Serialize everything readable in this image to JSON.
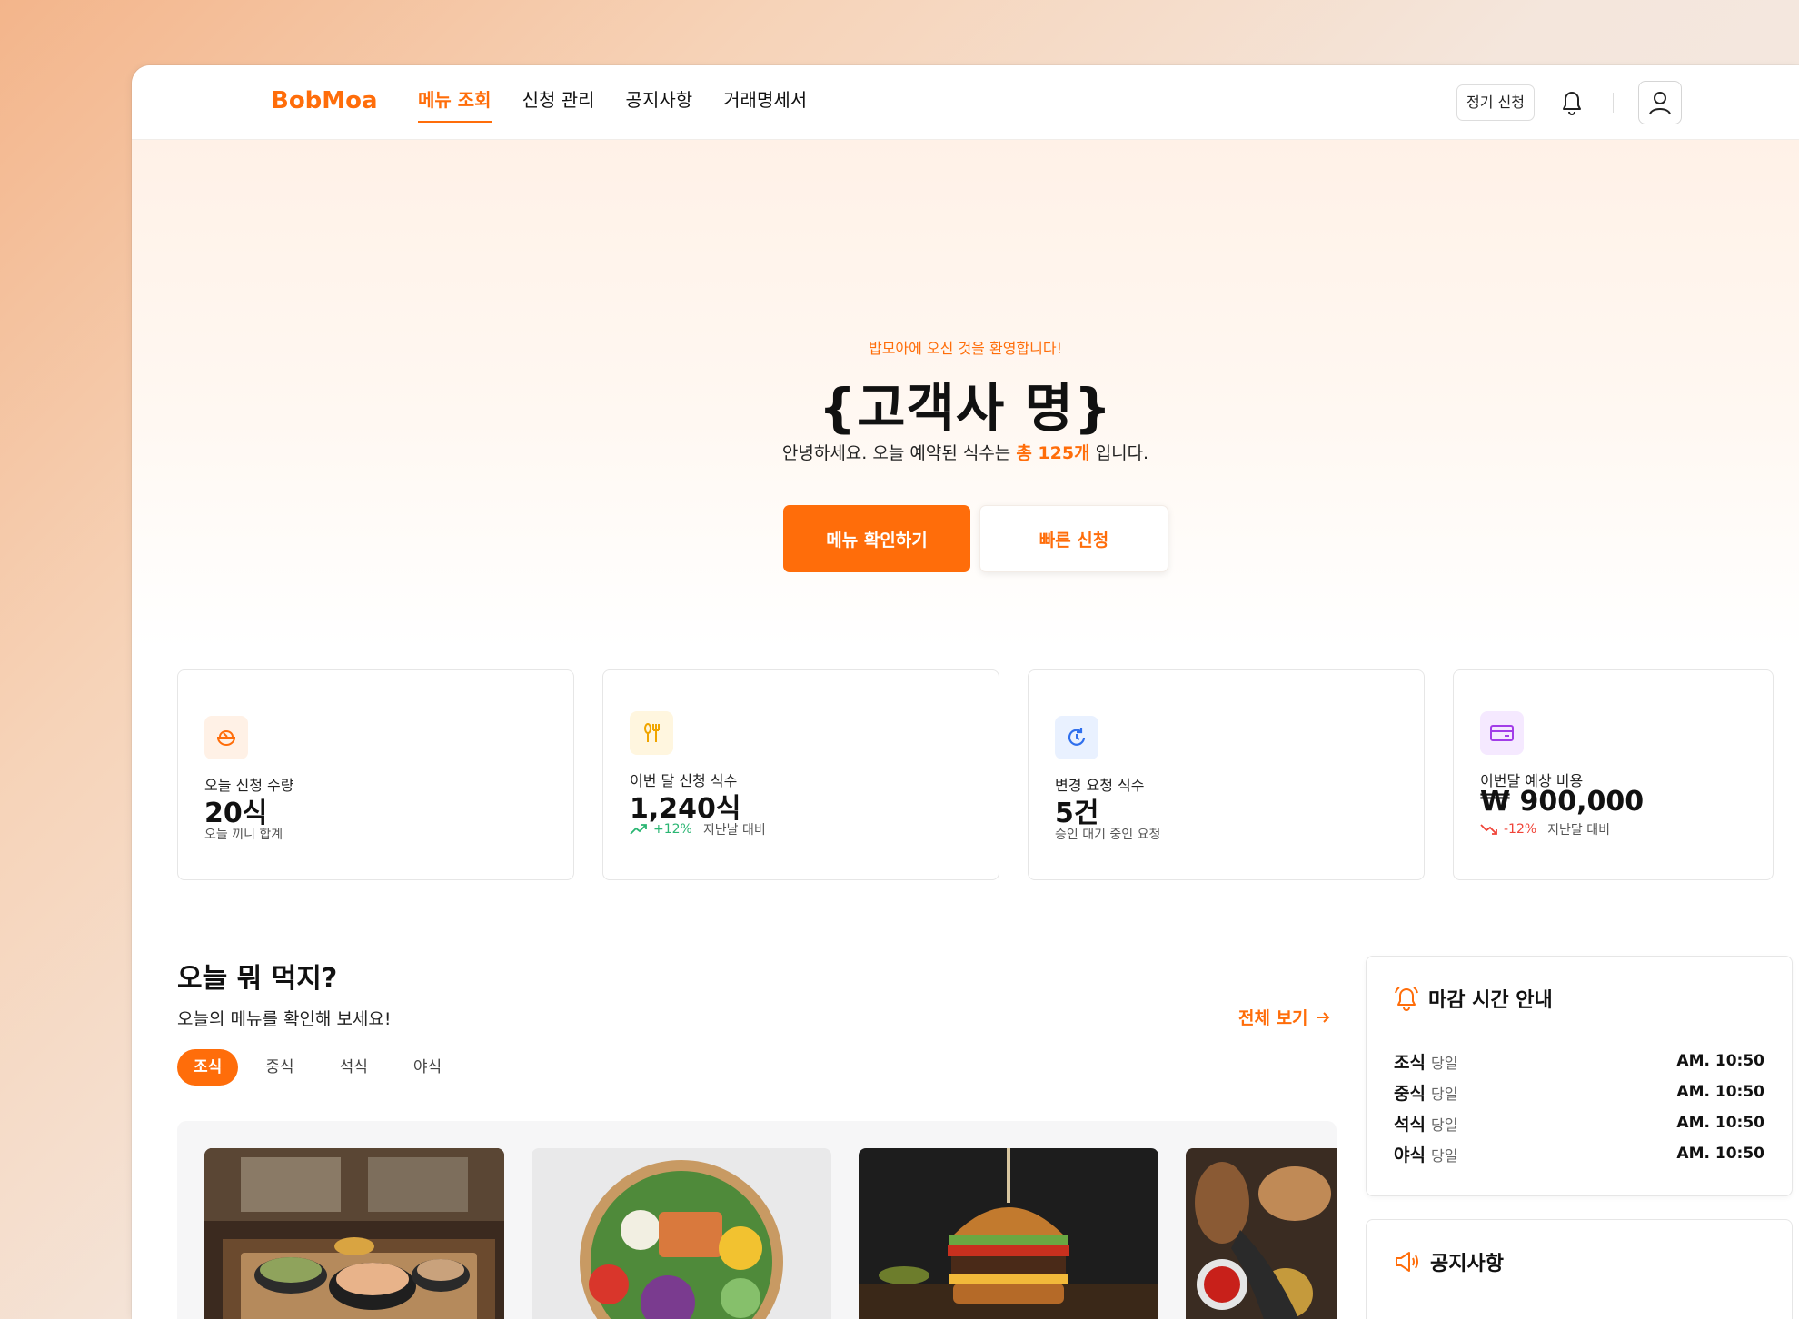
{
  "header": {
    "logo": "BobMoa",
    "nav": [
      "메뉴 조회",
      "신청 관리",
      "공지사항",
      "거래명세서"
    ],
    "regular_btn": "정기 신청"
  },
  "hero": {
    "welcome": "밥모아에 오신 것을 환영합니다!",
    "title": "{고객사 명}",
    "sub_prefix": "안녕하세요. 오늘 예약된 식수는 ",
    "sub_highlight": "총 125개",
    "sub_suffix": " 입니다.",
    "btn_primary": "메뉴 확인하기",
    "btn_secondary": "빠른 신청"
  },
  "stats": [
    {
      "label": "오늘 신청 수량",
      "value": "20식",
      "note": "오늘 끼니 합계",
      "icon": "bowl-icon"
    },
    {
      "label": "이번 달 신청 식수",
      "value": "1,240식",
      "trend": "+12%",
      "note": "지난날 대비",
      "icon": "utensils-icon"
    },
    {
      "label": "변경 요청 식수",
      "value": "5건",
      "note": "승인 대기 중인 요청",
      "icon": "refresh-icon"
    },
    {
      "label": "이번달 예상 비용",
      "value": "₩ 900,000",
      "trend": "-12%",
      "note": "지난달 대비",
      "icon": "card-icon"
    }
  ],
  "menu_section": {
    "title": "오늘 뭐 먹지?",
    "subtitle": "오늘의 메뉴를 확인해 보세요!",
    "view_all": "전체 보기",
    "tabs": [
      "조식",
      "중식",
      "석식",
      "야식"
    ]
  },
  "deadline": {
    "title": "마감 시간 안내",
    "rows": [
      {
        "meal": "조식",
        "when": "당일",
        "time": "AM. 10:50"
      },
      {
        "meal": "중식",
        "when": "당일",
        "time": "AM. 10:50"
      },
      {
        "meal": "석식",
        "when": "당일",
        "time": "AM. 10:50"
      },
      {
        "meal": "야식",
        "when": "당일",
        "time": "AM. 10:50"
      }
    ]
  },
  "notice": {
    "title": "공지사항"
  },
  "colors": {
    "accent": "#ff6d0a",
    "up": "#2bb673",
    "down": "#f04438"
  }
}
